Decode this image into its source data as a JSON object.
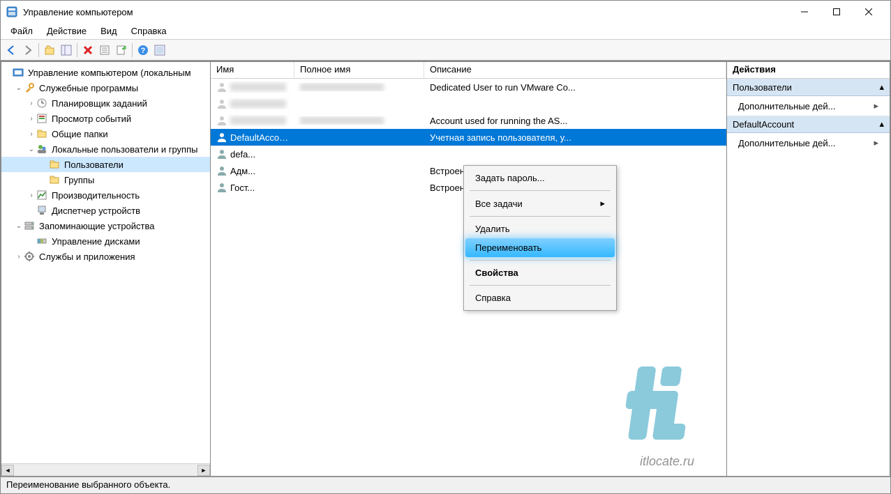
{
  "title": "Управление компьютером",
  "menubar": [
    "Файл",
    "Действие",
    "Вид",
    "Справка"
  ],
  "tree": {
    "root": "Управление компьютером (локальным",
    "n1": "Служебные программы",
    "n1a": "Планировщик заданий",
    "n1b": "Просмотр событий",
    "n1c": "Общие папки",
    "n1d": "Локальные пользователи и группы",
    "n1d1": "Пользователи",
    "n1d2": "Группы",
    "n1e": "Производительность",
    "n1f": "Диспетчер устройств",
    "n2": "Запоминающие устройства",
    "n2a": "Управление дисками",
    "n3": "Службы и приложения"
  },
  "columns": {
    "name": "Имя",
    "full": "Полное имя",
    "desc": "Описание"
  },
  "rows": [
    {
      "name": "",
      "full": "",
      "desc": "Dedicated User to run VMware Co...",
      "blurred": true
    },
    {
      "name": "",
      "full": "",
      "desc": "",
      "blurred": true
    },
    {
      "name": "",
      "full": "",
      "desc": "Account used for running the AS...",
      "blurred": true
    },
    {
      "name": "DefaultAccount",
      "full": "",
      "desc": "Учетная запись пользователя, у...",
      "selected": true,
      "truncated": true
    },
    {
      "name": "defa...",
      "full": "",
      "desc": ""
    },
    {
      "name": "Адм...",
      "full": "",
      "desc": "Встроенная учетная запись адм..."
    },
    {
      "name": "Гост...",
      "full": "",
      "desc": "Встроенная учетная запись для ..."
    }
  ],
  "context_menu": {
    "set_password": "Задать пароль...",
    "all_tasks": "Все задачи",
    "delete": "Удалить",
    "rename": "Переименовать",
    "properties": "Свойства",
    "help": "Справка"
  },
  "actions": {
    "header": "Действия",
    "group1": "Пользователи",
    "group1_item": "Дополнительные дей...",
    "group2": "DefaultAccount",
    "group2_item": "Дополнительные дей..."
  },
  "statusbar": "Переименование выбранного объекта.",
  "watermark": "itlocate.ru"
}
